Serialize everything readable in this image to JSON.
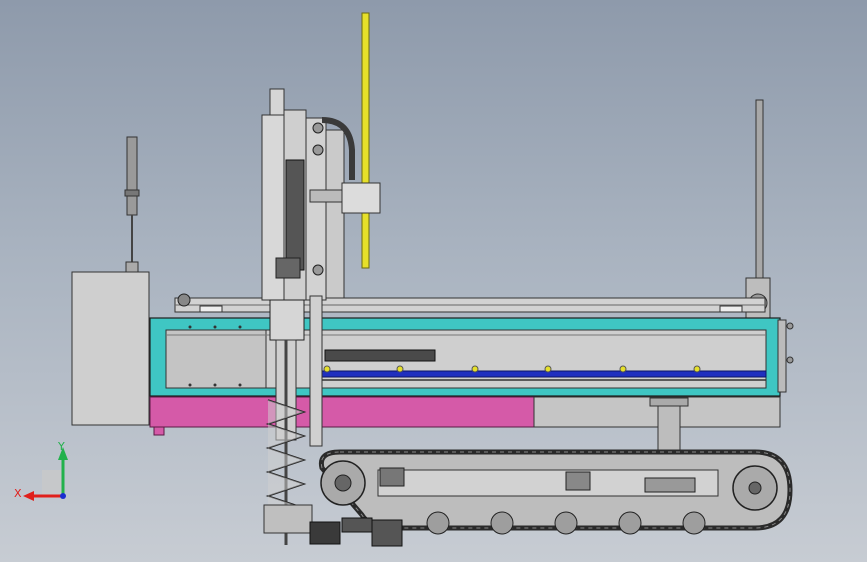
{
  "triad": {
    "x_label": "X",
    "y_label": "Y",
    "x_color": "#e0201c",
    "y_color": "#22b14c",
    "z_color": "#1a2fd0"
  },
  "colors": {
    "frame_cyan": "#3fc6c3",
    "skirt_magenta": "#d55aa8",
    "guide_blue": "#1f2fbf",
    "mast_yellow": "#e6e02a",
    "body_grey": "#c9c9c9",
    "track_dark": "#3a3a3a"
  }
}
